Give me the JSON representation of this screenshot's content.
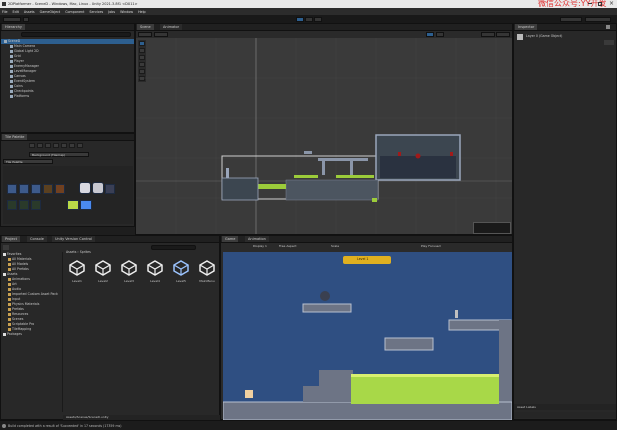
{
  "window": {
    "title": "2DPlatformer - SceneD - Windows, Mac, Linux - Unity 2021.3.8f1 <DX11>",
    "watermark": "微信公众号:YY开发"
  },
  "menu": [
    "File",
    "Edit",
    "Assets",
    "GameObject",
    "Component",
    "Services",
    "Jobs",
    "Window",
    "Help"
  ],
  "tabs": {
    "hierarchy": "Hierarchy",
    "scene": "Scene",
    "animator": "Animator",
    "tile_palette": "Tile Palette",
    "project": "Project",
    "console": "Console",
    "unity_version_control": "Unity Version Control",
    "game": "Game",
    "animation": "Animation",
    "inspector": "Inspector"
  },
  "hierarchy": {
    "items": [
      {
        "label": "SceneD",
        "depth": 0,
        "selected": true
      },
      {
        "label": "Main Camera",
        "depth": 1
      },
      {
        "label": "Global Light 2D",
        "depth": 1
      },
      {
        "label": "Grid",
        "depth": 1
      },
      {
        "label": "Player",
        "depth": 1
      },
      {
        "label": "EnemyManager",
        "depth": 1
      },
      {
        "label": "LevelManager",
        "depth": 1
      },
      {
        "label": "Canvas",
        "depth": 1
      },
      {
        "label": "EventSystem",
        "depth": 1
      },
      {
        "label": "Coins",
        "depth": 1
      },
      {
        "label": "Checkpoints",
        "depth": 1
      },
      {
        "label": "Platforms",
        "depth": 1
      }
    ]
  },
  "tile_palette": {
    "active_target": "Background (Tilemap)",
    "palette": "Tile Palette"
  },
  "project": {
    "breadcrumb": [
      "Assets",
      "Sprites"
    ],
    "tree": [
      {
        "label": "Favorites",
        "depth": 0
      },
      {
        "label": "All Materials",
        "depth": 1
      },
      {
        "label": "All Models",
        "depth": 1
      },
      {
        "label": "All Prefabs",
        "depth": 1
      },
      {
        "label": "Assets",
        "depth": 0
      },
      {
        "label": "Animations",
        "depth": 1
      },
      {
        "label": "Art",
        "depth": 1
      },
      {
        "label": "Audio",
        "depth": 1
      },
      {
        "label": "Imported Custom Asset Pack",
        "depth": 1
      },
      {
        "label": "Input",
        "depth": 1
      },
      {
        "label": "Physics Materials",
        "depth": 1
      },
      {
        "label": "Prefabs",
        "depth": 1
      },
      {
        "label": "Resources",
        "depth": 1
      },
      {
        "label": "Scenes",
        "depth": 1
      },
      {
        "label": "Scriptable Pro",
        "depth": 1
      },
      {
        "label": "TileMapping",
        "depth": 1
      },
      {
        "label": "Packages",
        "depth": 0
      }
    ],
    "assets": [
      "Level1",
      "Level2",
      "Level3",
      "Level4",
      "Level5",
      "MainMenu"
    ],
    "footer": "Assets/Scenes/SceneD.unity"
  },
  "game": {
    "display": "Display 1",
    "aspect": "Free Aspect",
    "scale": "Scale",
    "play_focused": "Play Focused",
    "banner": "Level 1"
  },
  "inspector": {
    "object": "Layer 0 (Game Object)",
    "footer_label": "Asset Labels"
  },
  "status": {
    "message": "Build completed with a result of 'Succeeded' in 17 seconds (17359 ms)"
  }
}
